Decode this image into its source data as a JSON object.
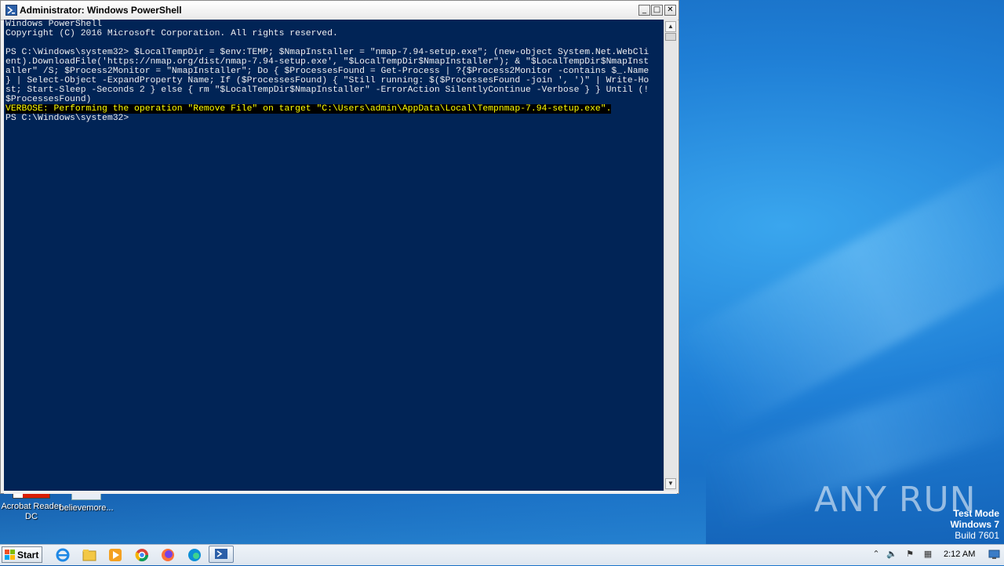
{
  "window": {
    "title": "Administrator: Windows PowerShell",
    "buttons": {
      "minimize": "_",
      "maximize": "□",
      "close": "✕"
    }
  },
  "console": {
    "lines": [
      "Windows PowerShell",
      "Copyright (C) 2016 Microsoft Corporation. All rights reserved.",
      "",
      "PS C:\\Windows\\system32> $LocalTempDir = $env:TEMP; $NmapInstaller = \"nmap-7.94-setup.exe\"; (new-object System.Net.WebCli",
      "ent).DownloadFile('https://nmap.org/dist/nmap-7.94-setup.exe', \"$LocalTempDir$NmapInstaller\"); & \"$LocalTempDir$NmapInst",
      "aller\" /S; $Process2Monitor = \"NmapInstaller\"; Do { $ProcessesFound = Get-Process | ?{$Process2Monitor -contains $_.Name",
      "} | Select-Object -ExpandProperty Name; If ($ProcessesFound) { \"Still running: $($ProcessesFound -join ', ')\" | Write-Ho",
      "st; Start-Sleep -Seconds 2 } else { rm \"$LocalTempDir$NmapInstaller\" -ErrorAction SilentlyContinue -Verbose } } Until (!",
      "$ProcessesFound)"
    ],
    "verbose_line": "VERBOSE: Performing the operation \"Remove File\" on target \"C:\\Users\\admin\\AppData\\Local\\Tempnmap-7.94-setup.exe\".",
    "prompt": "PS C:\\Windows\\system32>"
  },
  "desktop": {
    "icons": [
      {
        "label": "Acrobat Reader DC"
      },
      {
        "label": "believemore..."
      }
    ],
    "watermark": "ANY RUN",
    "test_mode": {
      "line1": "Test Mode",
      "line2": "Windows 7",
      "line3": "Build 7601"
    }
  },
  "taskbar": {
    "start_label": "Start",
    "pinned": [
      "internet-explorer",
      "windows-explorer",
      "media-player",
      "chrome",
      "firefox",
      "edge",
      "powershell"
    ],
    "clock": "2:12 AM"
  },
  "colors": {
    "console_bg": "#012456",
    "console_fg": "#eeedf0",
    "verbose_fg": "#ffff00",
    "verbose_bg": "#000000"
  }
}
